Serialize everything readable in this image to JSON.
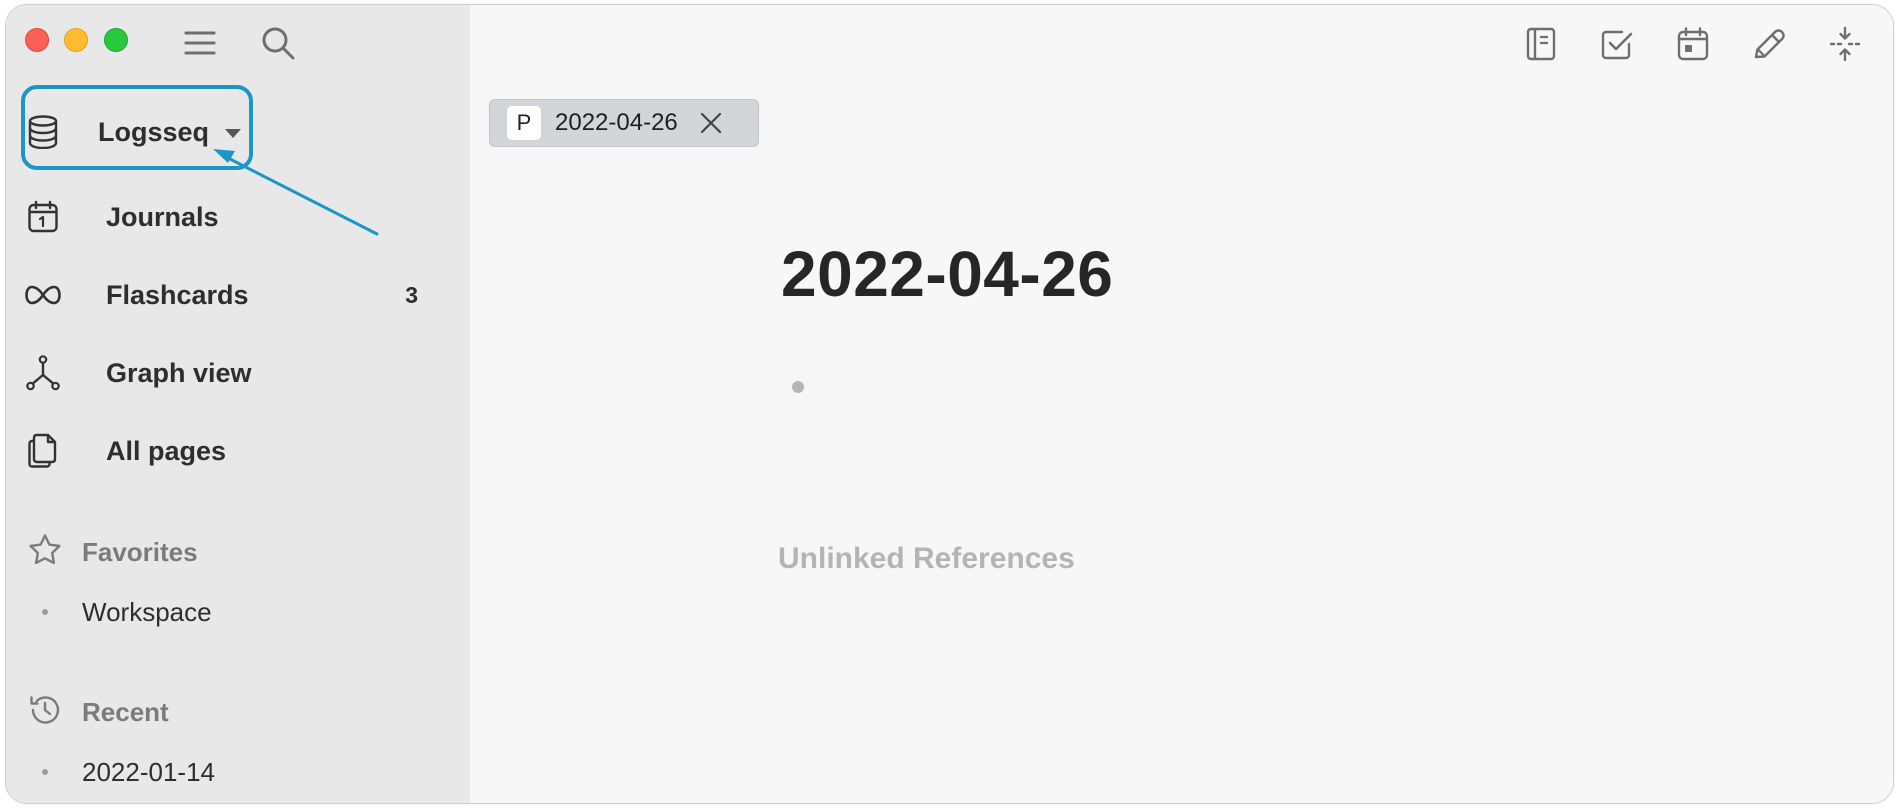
{
  "window": {
    "traffic_lights": [
      "close",
      "minimize",
      "maximize"
    ]
  },
  "toolbar_left": {
    "icons": [
      "menu-icon",
      "search-icon"
    ]
  },
  "toolbar_right": {
    "icons": [
      "journal-book-icon",
      "checkbox-icon",
      "calendar-icon",
      "pencil-icon",
      "collapse-icon"
    ]
  },
  "sidebar": {
    "graph": {
      "label": "Logsseq",
      "icon": "database-icon"
    },
    "nav": [
      {
        "label": "Journals",
        "icon": "calendar-icon"
      },
      {
        "label": "Flashcards",
        "icon": "infinity-icon",
        "count": "3"
      },
      {
        "label": "Graph view",
        "icon": "graph-icon"
      },
      {
        "label": "All pages",
        "icon": "pages-icon"
      }
    ],
    "favorites": {
      "label": "Favorites",
      "icon": "star-icon",
      "items": [
        "Workspace"
      ]
    },
    "recent": {
      "label": "Recent",
      "icon": "history-icon",
      "items": [
        "2022-01-14"
      ]
    }
  },
  "tab": {
    "badge": "P",
    "label": "2022-04-26"
  },
  "page": {
    "title": "2022-04-26",
    "unlinked_references": "Unlinked References"
  },
  "colors": {
    "highlight": "#1a96c9",
    "sidebar_bg": "#e8e8e9",
    "main_bg": "#f7f7f8"
  }
}
